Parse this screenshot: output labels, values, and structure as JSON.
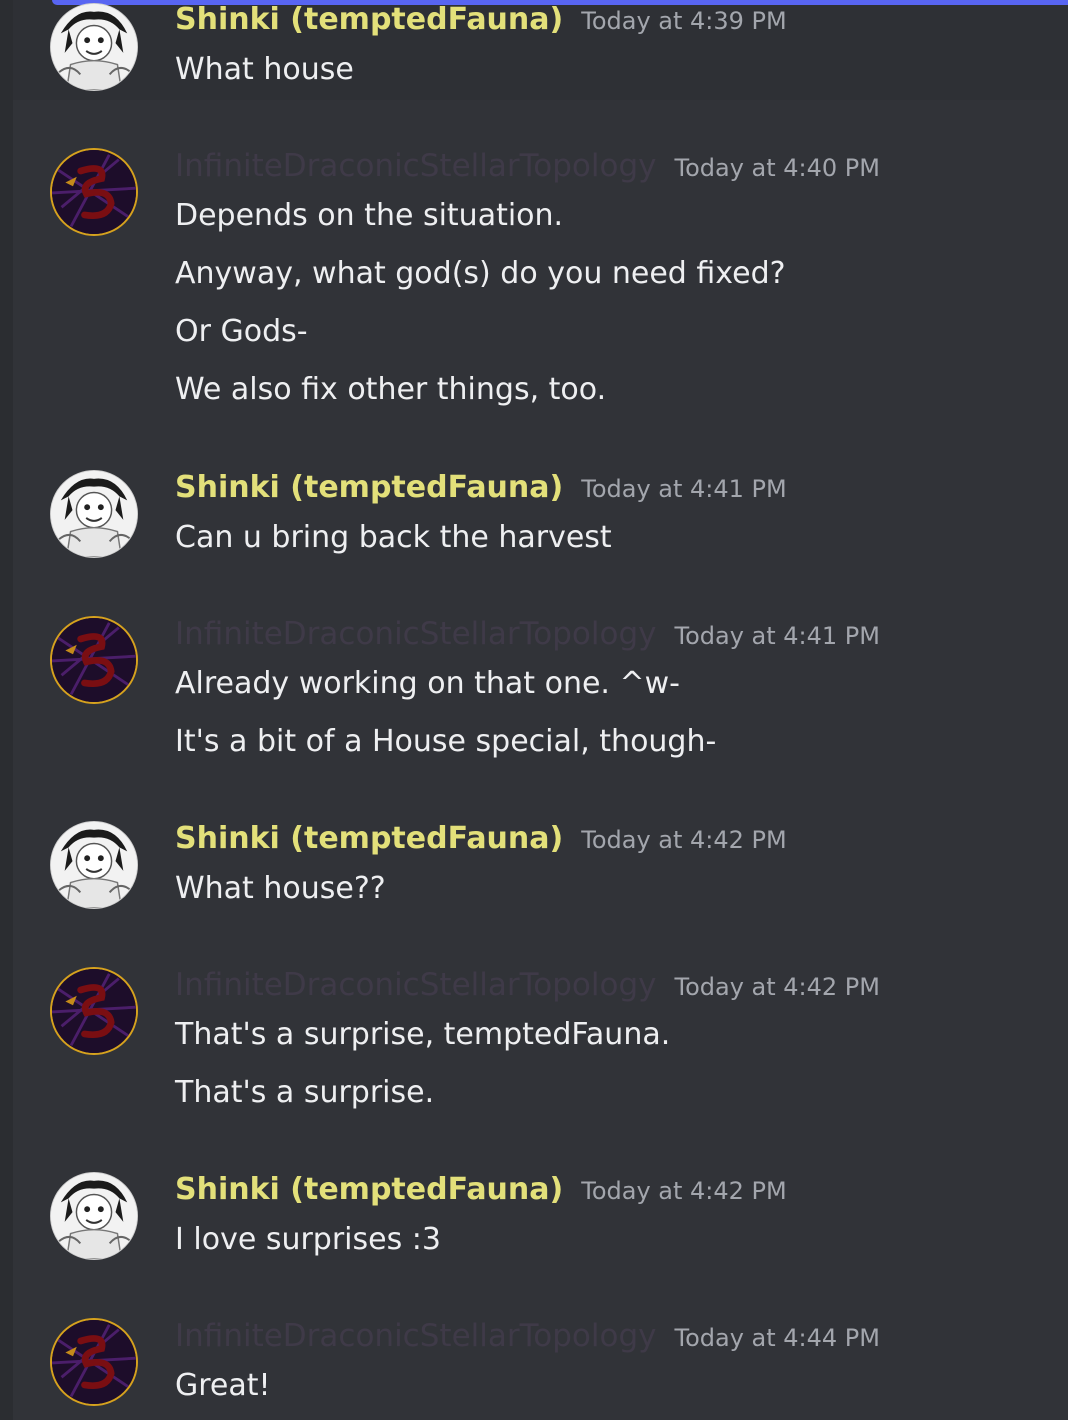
{
  "accent_color": "#5865f2",
  "users": {
    "shinki": {
      "name": "Shinki (temptedFauna)",
      "color": "#e3e07a",
      "avatar": "shinki-avatar"
    },
    "idst": {
      "name": "InfiniteDraconicStellarTopology",
      "color": "#3f3a48",
      "avatar": "dragon-avatar"
    }
  },
  "messages": [
    {
      "author": "Shinki (temptedFauna)",
      "time": "Today at 4:39 PM",
      "lines": [
        "What house"
      ]
    },
    {
      "author": "InfiniteDraconicStellarTopology",
      "time": "Today at 4:40 PM",
      "lines": [
        "Depends on the situation.",
        "Anyway, what god(s) do you need fixed?",
        "Or Gods-",
        "We also fix other things, too."
      ]
    },
    {
      "author": "Shinki (temptedFauna)",
      "time": "Today at 4:41 PM",
      "lines": [
        "Can u bring back the harvest"
      ]
    },
    {
      "author": "InfiniteDraconicStellarTopology",
      "time": "Today at 4:41 PM",
      "lines": [
        "Already working on that one. ^w-",
        "It's a bit of a House special, though-"
      ]
    },
    {
      "author": "Shinki (temptedFauna)",
      "time": "Today at 4:42 PM",
      "lines": [
        "What house??"
      ]
    },
    {
      "author": "InfiniteDraconicStellarTopology",
      "time": "Today at 4:42 PM",
      "lines": [
        "That's a surprise, temptedFauna.",
        "That's a surprise."
      ]
    },
    {
      "author": "Shinki (temptedFauna)",
      "time": "Today at 4:42 PM",
      "lines": [
        "I love surprises :3"
      ]
    },
    {
      "author": "InfiniteDraconicStellarTopology",
      "time": "Today at 4:44 PM",
      "lines": [
        "Great!"
      ]
    }
  ]
}
